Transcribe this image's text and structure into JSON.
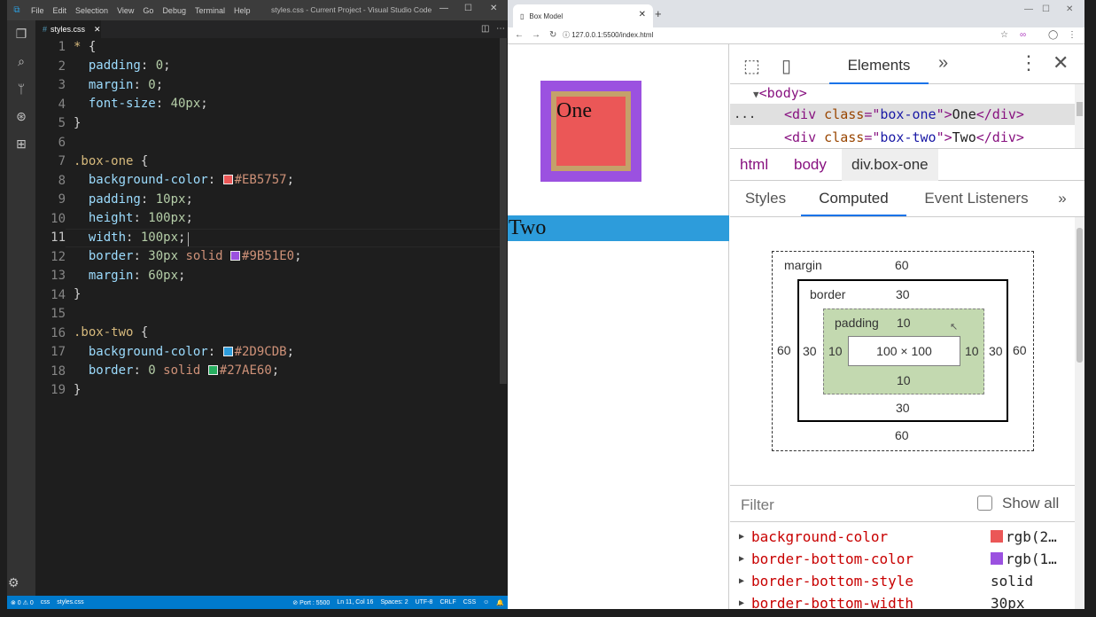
{
  "vscode": {
    "menu": [
      "File",
      "Edit",
      "Selection",
      "View",
      "Go",
      "Debug",
      "Terminal",
      "Help"
    ],
    "window_title": "styles.css - Current Project - Visual Studio Code",
    "tab_label": "styles.css",
    "status": {
      "problems": "⊗ 0 ⚠ 0",
      "branch": "css",
      "file": "styles.css",
      "port": "⊘ Port : 5500",
      "position": "Ln 11, Col 16",
      "spaces": "Spaces: 2",
      "encoding": "UTF-8",
      "eol": "CRLF",
      "language": "CSS"
    },
    "line_numbers": [
      "1",
      "2",
      "3",
      "4",
      "5",
      "6",
      "7",
      "8",
      "9",
      "10",
      "11",
      "12",
      "13",
      "14",
      "15",
      "16",
      "17",
      "18",
      "19"
    ],
    "code": {
      "l1_sel": "* ",
      "l1_brace": "{",
      "l2_prop": "padding",
      "l2_val": "0",
      "l3_prop": "margin",
      "l3_val": "0",
      "l4_prop": "font-size",
      "l4_val": "40px",
      "l5": "}",
      "l7_sel": ".box-one ",
      "l7_brace": "{",
      "l8_prop": "background-color",
      "l8_val": "#EB5757",
      "l9_prop": "padding",
      "l9_val": "10px",
      "l10_prop": "height",
      "l10_val": "100px",
      "l11_prop": "width",
      "l11_val": "100px",
      "l12_prop": "border",
      "l12_val1": "30px",
      "l12_val2": "solid",
      "l12_val3": "#9B51E0",
      "l13_prop": "margin",
      "l13_val": "60px",
      "l14": "}",
      "l16_sel": ".box-two ",
      "l16_brace": "{",
      "l17_prop": "background-color",
      "l17_val": "#2D9CDB",
      "l18_prop": "border",
      "l18_val1": "0",
      "l18_val2": "solid",
      "l18_val3": "#27AE60",
      "l19": "}"
    },
    "swatch_colors": {
      "l8": "#EB5757",
      "l12": "#9B51E0",
      "l17": "#2D9CDB",
      "l18": "#27AE60"
    }
  },
  "chrome": {
    "tab_title": "Box Model",
    "url": "127.0.0.1:5500/index.html",
    "page": {
      "box_one": "One",
      "box_two": "Two"
    },
    "devtools": {
      "panel_tab": "Elements",
      "dom": {
        "body_tag": "<body>",
        "row1": {
          "open": "<div ",
          "attr": "class",
          "eq": "=\"",
          "val": "box-one",
          "close": "\">",
          "text": "One",
          "end": "</div>"
        },
        "row2": {
          "open": "<div ",
          "attr": "class",
          "eq": "=\"",
          "val": "box-two",
          "close": "\">",
          "text": "Two",
          "end": "</div>"
        },
        "ellipsis": "..."
      },
      "breadcrumbs": [
        "html",
        "body",
        "div.box-one"
      ],
      "subtabs": [
        "Styles",
        "Computed",
        "Event Listeners"
      ],
      "box_model": {
        "margin_label": "margin",
        "margin": "60",
        "border_label": "border",
        "border": "30",
        "padding_label": "padding",
        "padding": "10",
        "content": "100 × 100",
        "margin_bottom": "60",
        "border_bottom": "30",
        "padding_bottom": "10",
        "margin_left": "60",
        "border_left": "30",
        "padding_left": "10",
        "padding_right": "10",
        "border_right": "30",
        "margin_right": "60"
      },
      "filter_placeholder": "Filter",
      "show_all": "Show all",
      "computed_props": [
        {
          "name": "background-color",
          "value": "rgb(2…",
          "swatch": "#EB5757"
        },
        {
          "name": "border-bottom-color",
          "value": "rgb(1…",
          "swatch": "#9B51E0"
        },
        {
          "name": "border-bottom-style",
          "value": "solid"
        },
        {
          "name": "border-bottom-width",
          "value": "30px"
        }
      ]
    }
  }
}
